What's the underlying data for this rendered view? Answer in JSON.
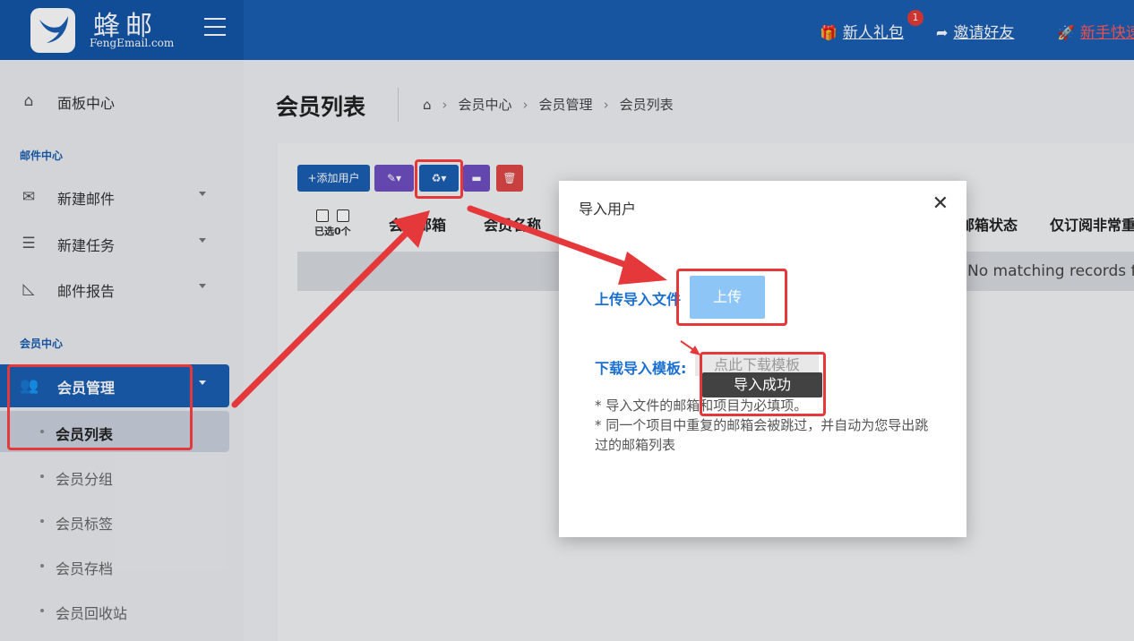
{
  "header": {
    "brand_name": "蜂邮",
    "brand_sub": "FengEmail.com",
    "links": [
      {
        "label": "新人礼包",
        "icon": "gift-icon"
      },
      {
        "label": "邀请好友",
        "icon": "share-icon"
      },
      {
        "label": "新手快速",
        "icon": "rocket-icon"
      }
    ],
    "badge_count": "1"
  },
  "sidebar": {
    "dashboard": "面板中心",
    "section_mail": "邮件中心",
    "mail_items": [
      "新建邮件",
      "新建任务",
      "邮件报告"
    ],
    "section_member": "会员中心",
    "member_group": "会员管理",
    "member_subitems": [
      "会员列表",
      "会员分组",
      "会员标签",
      "会员存档",
      "会员回收站"
    ]
  },
  "main": {
    "page_title": "会员列表",
    "breadcrumb": [
      "会员中心",
      "会员管理",
      "会员列表"
    ],
    "toolbar": {
      "add_user": "+添加用户"
    },
    "selected_label": "已选0个",
    "columns": [
      "会员邮箱",
      "会员名称",
      "邮箱状态",
      "仅订阅非常重"
    ],
    "empty_text": "No matching records found"
  },
  "modal": {
    "title": "导入用户",
    "upload_label": "上传导入文件",
    "upload_button": "上传",
    "download_label": "下载导入模板:",
    "download_button": "点此下载模板",
    "toast": "导入成功",
    "notes": [
      "* 导入文件的邮箱和项目为必填项。",
      "* 同一个项目中重复的邮箱会被跳过，并自动为您导出跳过的邮箱列表"
    ]
  },
  "colors": {
    "primary": "#1a5fb4",
    "annotation": "#e5383b",
    "upload_button": "#8ec5f7"
  }
}
